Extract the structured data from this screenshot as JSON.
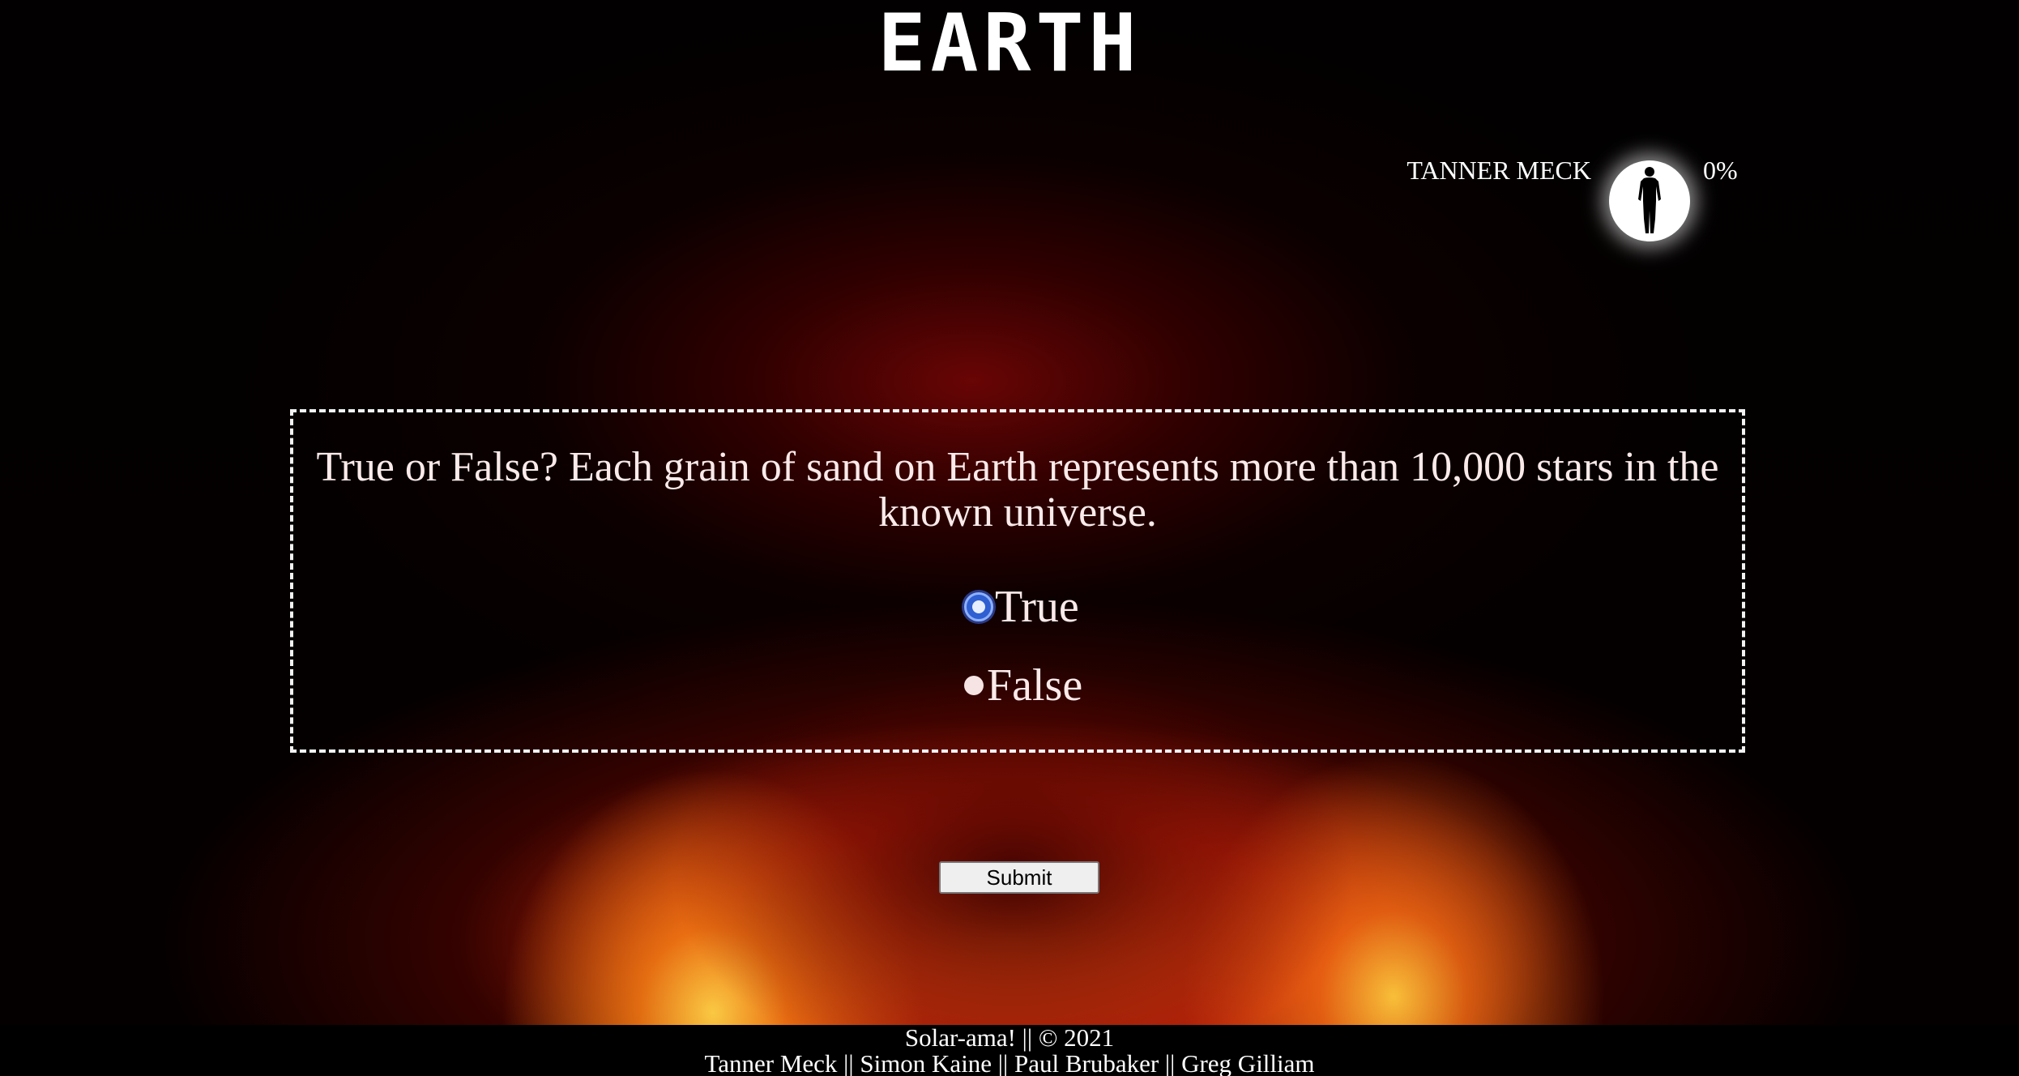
{
  "header": {
    "title": "EARTH"
  },
  "player": {
    "name": "TANNER MECK",
    "avatar_icon": "human-silhouette-icon",
    "progress": "0%"
  },
  "quiz": {
    "question": "True or False? Each grain of sand on Earth represents more than 10,000 stars in the known universe.",
    "options": [
      {
        "label": "True",
        "selected": true
      },
      {
        "label": "False",
        "selected": false
      }
    ],
    "submit_label": "Submit"
  },
  "footer": {
    "line1": "Solar-ama! || © 2021",
    "line2": "Tanner Meck || Simon Kaine || Paul Brubaker || Greg Gilliam"
  },
  "colors": {
    "background": "#000000",
    "text": "#ffffff",
    "radio_selected": "#2f5fd0"
  }
}
